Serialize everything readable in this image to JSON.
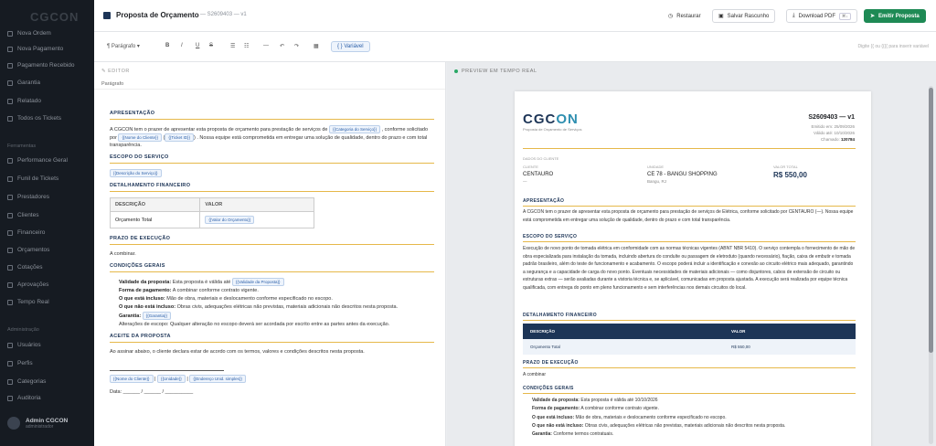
{
  "sidebar": {
    "brand": "CGCON",
    "items": [
      {
        "label": "Nova Ordem",
        "top": 0
      },
      {
        "label": "Nova Pagamento"
      },
      {
        "label": "Pagamento Recebido"
      },
      {
        "label": "Garantia"
      },
      {
        "label": "Relatado"
      },
      {
        "label": "Todos os Tickets"
      }
    ],
    "section2": "Ferramentas",
    "items2": [
      {
        "label": "Performance Geral"
      },
      {
        "label": "Funil de Tickets"
      },
      {
        "label": "Prestadores"
      },
      {
        "label": "Clientes"
      },
      {
        "label": "Financeiro"
      },
      {
        "label": "Orçamentos"
      },
      {
        "label": "Cotações"
      },
      {
        "label": "Aprovações"
      },
      {
        "label": "Tempo Real"
      }
    ],
    "section3": "Administração",
    "items3": [
      {
        "label": "Usuários"
      },
      {
        "label": "Perfis"
      },
      {
        "label": "Categorias"
      },
      {
        "label": "Auditoria"
      }
    ],
    "user_name": "Admin CGCON",
    "user_role": "administrador"
  },
  "header": {
    "title": "Proposta de Orçamento",
    "subtitle": "— S2609403 — v1",
    "restore_label": "Restaurar",
    "save_label": "Salvar Rascunho",
    "download_label": "Download PDF",
    "download_kbd": "⌘↓",
    "emit_label": "Emitir Proposta"
  },
  "toolbar": {
    "paragraph": "Parágrafo",
    "bold": "B",
    "italic": "I",
    "underline": "U",
    "strike": "S",
    "list_ul": "☰",
    "list_ol": "☷",
    "hr": "—",
    "undo": "↶",
    "redo": "↷",
    "variable": "{ } Variável",
    "hint": "Digite {{ ou {{{{ para inserir variável"
  },
  "editor": {
    "tab": "EDITOR",
    "para": "Parágrafo",
    "h_apresentacao": "APRESENTAÇÃO",
    "p_apresentacao_1": "A CGCON tem o prazer de apresentar esta proposta de orçamento para prestação de serviços de",
    "chip_categoria": "{{Categoria do Serviço}}",
    "p_apresentacao_2": ", conforme solicitado por",
    "chip_cliente": "{{Nome do Cliente}}",
    "chip_ticket": "{{Ticket ID}}",
    "p_apresentacao_3": ". Nossa equipe está comprometida em entregar uma solução de qualidade, dentro do prazo e com total transparência.",
    "h_escopo": "ESCOPO DO SERVIÇO",
    "chip_descricao": "{{Descrição do Serviço}}",
    "h_detalhamento": "DETALHAMENTO FINANCEIRO",
    "th_descricao": "DESCRIÇÃO",
    "th_valor": "VALOR",
    "td_orcamento": "Orçamento Total",
    "chip_valor": "{{Valor do Orçamento}}",
    "h_prazo": "PRAZO DE EXECUÇÃO",
    "p_prazo": "A combinar.",
    "h_condicoes": "CONDIÇÕES GERAIS",
    "c1_label": "Validade da proposta:",
    "c1_text": "Esta proposta é válida até",
    "chip_validade": "{{Validade da Proposta}}",
    "c2_label": "Forma de pagamento:",
    "c2_text": "A combinar conforme contrato vigente.",
    "c3_label": "O que está incluso:",
    "c3_text": "Mão de obra, materiais e deslocamento conforme especificado no escopo.",
    "c4_label": "O que não está incluso:",
    "c4_text": "Obras civis, adequações elétricas não previstas, materiais adicionais não descritos nesta proposta.",
    "c5_label": "Garantia:",
    "chip_garantia": "{{Garantia}}",
    "c6_text": "Alterações de escopo: Qualquer alteração no escopo deverá ser acordada por escrito entre as partes antes da execução.",
    "h_aceite": "ACEITE DA PROPOSTA",
    "p_aceite": "Ao assinar abaixo, o cliente declara estar de acordo com os termos, valores e condições descritos nesta proposta.",
    "chip_sig_nome": "{{Nome do Cliente}}",
    "chip_sig_unidade": "{{Unidade}}",
    "chip_sig_endereco": "{{Endereço Unid. simples}}",
    "sig_data": "Data: ______ / ______ / __________"
  },
  "preview": {
    "tab": "PREVIEW EM TEMPO REAL",
    "logo": "CGC",
    "logo_accent": "ON",
    "logo_sub": "Proposta de Orçamento de Serviços",
    "number": "S2609403 — v1",
    "meta_emitido": "Emitido em: 25/09/2026",
    "meta_validade": "Válido até: 10/10/2026",
    "meta_chamado_label": "Chamado:",
    "meta_chamado": "120784",
    "dados_label": "DADOS DO CLIENTE",
    "cliente_label": "CLIENTE",
    "cliente": "CENTAURO",
    "cliente_sub": "—",
    "unidade_label": "UNIDADE",
    "unidade": "CE 78 - BANGU SHOPPING",
    "unidade_sub": "Bangu, RJ",
    "valor_label": "VALOR TOTAL",
    "valor": "R$ 550,00",
    "h_apresentacao": "APRESENTAÇÃO",
    "p_apresentacao": "A CGCON tem o prazer de apresentar esta proposta de orçamento para prestação de serviços de Elétrica, conforme solicitado por CENTAURO (—). Nossa equipe está comprometida em entregar uma solução de qualidade, dentro do prazo e com total transparência.",
    "h_escopo": "ESCOPO DO SERVIÇO",
    "p_escopo": "Execução de novo ponto de tomada elétrica em conformidade com as normas técnicas vigentes (ABNT NBR 5410). O serviço contempla o fornecimento de mão de obra especializada para instalação da tomada, incluindo abertura do conduíte ou passagem de eletroduto (quando necessário), fiação, caixa de embutir e tomada padrão brasileiro, além do teste de funcionamento e acabamento. O escopo poderá incluir a identificação e conexão ao circuito elétrico mais adequado, garantindo a segurança e a capacidade de carga do novo ponto. Eventuais necessidades de materiais adicionais — como disjuntores, cabos de extensão de circuito ou estruturas extras — serão avaliadas durante a vistoria técnica e, se aplicável, comunicadas em proposta ajustada. A execução será realizada por equipe técnica qualificada, com entrega do ponto em pleno funcionamento e sem interferências nos demais circuitos do local.",
    "h_detalhamento": "DETALHAMENTO FINANCEIRO",
    "th_descricao": "DESCRIÇÃO",
    "th_valor": "VALOR",
    "td_orcamento": "Orçamento Total",
    "td_valor": "R$ 550,00",
    "h_prazo": "PRAZO DE EXECUÇÃO",
    "p_prazo": "A combinar",
    "h_condicoes": "CONDIÇÕES GERAIS",
    "c1_label": "Validade da proposta:",
    "c1_text": "Esta proposta é válida até 10/10/2026",
    "c2_label": "Forma de pagamento:",
    "c2_text": "A combinar conforme contrato vigente.",
    "c3_label": "O que está incluso:",
    "c3_text": "Mão de obra, materiais e deslocamento conforme especificado no escopo.",
    "c4_label": "O que não está incluso:",
    "c4_text": "Obras civis, adequações elétricas não previstas, materiais adicionais não descritos nesta proposta.",
    "c5_label": "Garantia:",
    "c5_text": "Conforme termos contratuais."
  }
}
